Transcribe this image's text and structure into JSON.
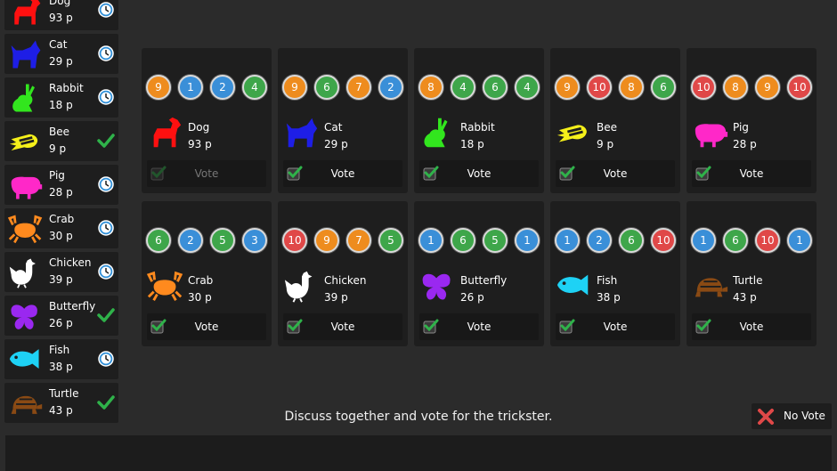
{
  "animals": {
    "dog": {
      "name": "Dog",
      "points": "93 p",
      "color": "#ff1010",
      "icon": "dog-icon"
    },
    "cat": {
      "name": "Cat",
      "points": "29 p",
      "color": "#1e1ee6",
      "icon": "cat-icon"
    },
    "rabbit": {
      "name": "Rabbit",
      "points": "18 p",
      "color": "#32e61e",
      "icon": "rabbit-icon"
    },
    "bee": {
      "name": "Bee",
      "points": "9 p",
      "color": "#f5f01a",
      "icon": "bee-icon"
    },
    "pig": {
      "name": "Pig",
      "points": "28 p",
      "color": "#ff28c8",
      "icon": "pig-icon"
    },
    "crab": {
      "name": "Crab",
      "points": "30 p",
      "color": "#ff8a1e",
      "icon": "crab-icon"
    },
    "chicken": {
      "name": "Chicken",
      "points": "39 p",
      "color": "#ffffff",
      "icon": "chicken-icon"
    },
    "butterfly": {
      "name": "Butterfly",
      "points": "26 p",
      "color": "#9a28f0",
      "icon": "butterfly-icon"
    },
    "fish": {
      "name": "Fish",
      "points": "38 p",
      "color": "#1ed2f5",
      "icon": "fish-icon"
    },
    "turtle": {
      "name": "Turtle",
      "points": "43 p",
      "color": "#8a4a14",
      "icon": "turtle-icon"
    }
  },
  "sidebar": [
    {
      "animal": "dog",
      "status": "clock"
    },
    {
      "animal": "cat",
      "status": "clock"
    },
    {
      "animal": "rabbit",
      "status": "clock"
    },
    {
      "animal": "bee",
      "status": "check"
    },
    {
      "animal": "pig",
      "status": "clock"
    },
    {
      "animal": "crab",
      "status": "clock"
    },
    {
      "animal": "chicken",
      "status": "clock"
    },
    {
      "animal": "butterfly",
      "status": "check"
    },
    {
      "animal": "fish",
      "status": "clock"
    },
    {
      "animal": "turtle",
      "status": "check"
    }
  ],
  "cards": [
    {
      "animal": "dog",
      "badges": [
        "9",
        "1",
        "2",
        "4"
      ],
      "vote_label": "Vote",
      "vote_enabled": false
    },
    {
      "animal": "cat",
      "badges": [
        "9",
        "6",
        "7",
        "2"
      ],
      "vote_label": "Vote",
      "vote_enabled": true
    },
    {
      "animal": "rabbit",
      "badges": [
        "8",
        "4",
        "6",
        "4"
      ],
      "vote_label": "Vote",
      "vote_enabled": true
    },
    {
      "animal": "bee",
      "badges": [
        "9",
        "10",
        "8",
        "6"
      ],
      "vote_label": "Vote",
      "vote_enabled": true
    },
    {
      "animal": "pig",
      "badges": [
        "10",
        "8",
        "9",
        "10"
      ],
      "vote_label": "Vote",
      "vote_enabled": true
    },
    {
      "animal": "crab",
      "badges": [
        "6",
        "2",
        "5",
        "3"
      ],
      "vote_label": "Vote",
      "vote_enabled": true
    },
    {
      "animal": "chicken",
      "badges": [
        "10",
        "9",
        "7",
        "5"
      ],
      "vote_label": "Vote",
      "vote_enabled": true
    },
    {
      "animal": "butterfly",
      "badges": [
        "1",
        "6",
        "5",
        "1"
      ],
      "vote_label": "Vote",
      "vote_enabled": true
    },
    {
      "animal": "fish",
      "badges": [
        "1",
        "2",
        "6",
        "10"
      ],
      "vote_label": "Vote",
      "vote_enabled": true
    },
    {
      "animal": "turtle",
      "badges": [
        "1",
        "6",
        "10",
        "1"
      ],
      "vote_label": "Vote",
      "vote_enabled": true
    }
  ],
  "badge_colors": {
    "1": "#3a8fd8",
    "2": "#3a8fd8",
    "3": "#3a8fd8",
    "4": "#3ea64a",
    "5": "#3ea64a",
    "6": "#3ea64a",
    "7": "#ee8c1e",
    "8": "#ee8c1e",
    "9": "#ee8c1e",
    "10": "#e04848"
  },
  "colors": {
    "check": "#2fb24a",
    "clock": "#2f8fd8",
    "no_vote_x": "#e04848"
  },
  "prompt": "Discuss together and vote for the trickster.",
  "no_vote": {
    "label": "No Vote",
    "icon": "x-icon"
  }
}
